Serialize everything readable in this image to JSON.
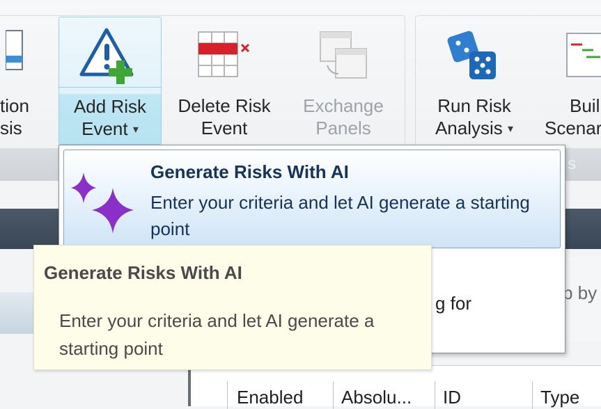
{
  "ribbon": {
    "partial_left_label_line1": "tion",
    "partial_left_label_line2": "sis",
    "add_risk_event": {
      "line1": "Add Risk",
      "line2": "Event"
    },
    "delete_risk_event": {
      "line1": "Delete Risk",
      "line2": "Event"
    },
    "exchange_panels": {
      "line1": "Exchange",
      "line2": "Panels"
    },
    "run_risk_analysis": {
      "line1": "Run Risk",
      "line2": "Analysis"
    },
    "build_scenario": {
      "line1": "Buil",
      "line2": "Scenar"
    },
    "group_bar_fragment": "s",
    "dropdown_chevron": "▾"
  },
  "dropdown": {
    "item": {
      "title": "Generate Risks With AI",
      "description": "Enter your criteria and let AI generate a starting point"
    },
    "second_item_fragment": "g for"
  },
  "tooltip": {
    "title": "Generate Risks With AI",
    "body": "Enter your criteria and let AI generate a starting point"
  },
  "right_pane_fragment": "p by",
  "grid": {
    "columns": [
      "Enabled",
      "Absolu...",
      "ID",
      "Type"
    ]
  },
  "colors": {
    "accent_blue": "#b7e3f2",
    "menu_text": "#16335c",
    "sparkle": "#8a2fc8",
    "tooltip_bg": "#fdfde9"
  }
}
